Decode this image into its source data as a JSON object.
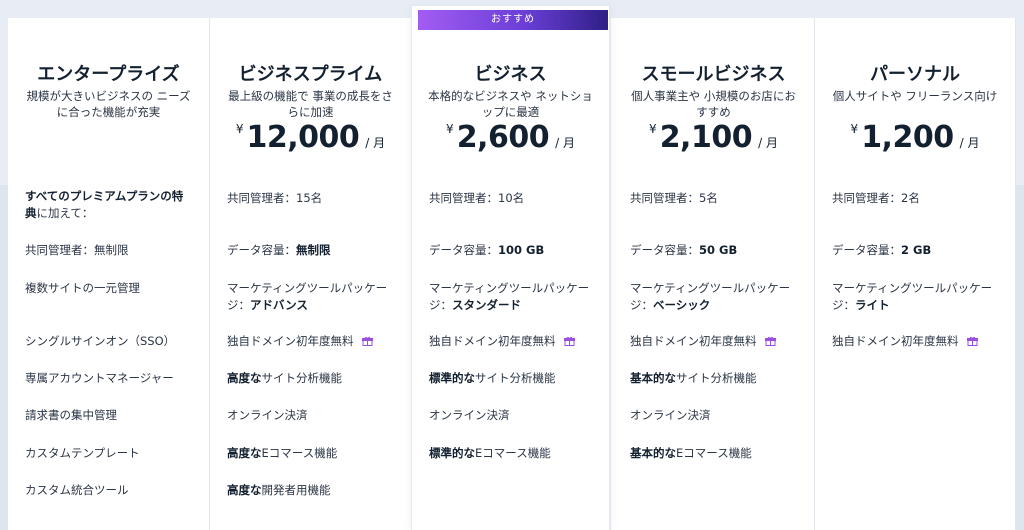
{
  "badge": "おすすめ",
  "currency": "¥",
  "per_month": "/ 月",
  "plans": [
    {
      "name": "エンタープライズ",
      "desc": "規模が大きいビジネスの ニーズに合った機能が充実",
      "intro_bold": "すべてのプレミアムプランの特典",
      "intro_rest": "に加えて：",
      "features": [
        "共同管理者：無制限",
        "複数サイトの一元管理",
        "シングルサインオン（SSO）",
        "専属アカウントマネージャー",
        "請求書の集中管理",
        "カスタムテンプレート",
        "カスタム統合ツール"
      ]
    },
    {
      "name": "ビジネスプライム",
      "desc": "最上級の機能で 事業の成長をさらに加速",
      "price": "12,000",
      "admins_label": "共同管理者：",
      "admins_value": "15",
      "admins_unit": "名",
      "storage_label": "データ容量：",
      "storage_value": "無制限",
      "marketing_label": "マーケティングツールパッケージ：",
      "marketing_value": "アドバンス",
      "domain": "独自ドメイン初年度無料",
      "analytics_bold": "高度な",
      "analytics_rest": "サイト分析機能",
      "payment": "オンライン決済",
      "ecommerce_bold": "高度な",
      "ecommerce_rest": "Eコマース機能",
      "dev_bold": "高度な",
      "dev_rest": "開発者用機能"
    },
    {
      "name": "ビジネス",
      "desc": "本格的なビジネスや ネットショップに最適",
      "price": "2,600",
      "admins_label": "共同管理者：",
      "admins_value": "10",
      "admins_unit": "名",
      "storage_label": "データ容量：",
      "storage_value": "100 GB",
      "marketing_label": "マーケティングツールパッケージ：",
      "marketing_value": "スタンダード",
      "domain": "独自ドメイン初年度無料",
      "analytics_bold": "標準的な",
      "analytics_rest": "サイト分析機能",
      "payment": "オンライン決済",
      "ecommerce_bold": "標準的な",
      "ecommerce_rest": "Eコマース機能"
    },
    {
      "name": "スモールビジネス",
      "desc": "個人事業主や 小規模のお店におすすめ",
      "price": "2,100",
      "admins_label": "共同管理者：",
      "admins_value": "5",
      "admins_unit": "名",
      "storage_label": "データ容量：",
      "storage_value": "50 GB",
      "marketing_label": "マーケティングツールパッケージ：",
      "marketing_value": "ベーシック",
      "domain": "独自ドメイン初年度無料",
      "analytics_bold": "基本的な",
      "analytics_rest": "サイト分析機能",
      "payment": "オンライン決済",
      "ecommerce_bold": "基本的な",
      "ecommerce_rest": "Eコマース機能"
    },
    {
      "name": "パーソナル",
      "desc": "個人サイトや フリーランス向け",
      "price": "1,200",
      "admins_label": "共同管理者：",
      "admins_value": "2",
      "admins_unit": "名",
      "storage_label": "データ容量：",
      "storage_value": "2 GB",
      "marketing_label": "マーケティングツールパッケージ：",
      "marketing_value": "ライト",
      "domain": "独自ドメイン初年度無料"
    }
  ],
  "colors": {
    "badge_start": "#a35cf2",
    "badge_end": "#2f1f86",
    "gift": "#9b4fe0"
  },
  "icons": {
    "gift": "gift-icon"
  }
}
